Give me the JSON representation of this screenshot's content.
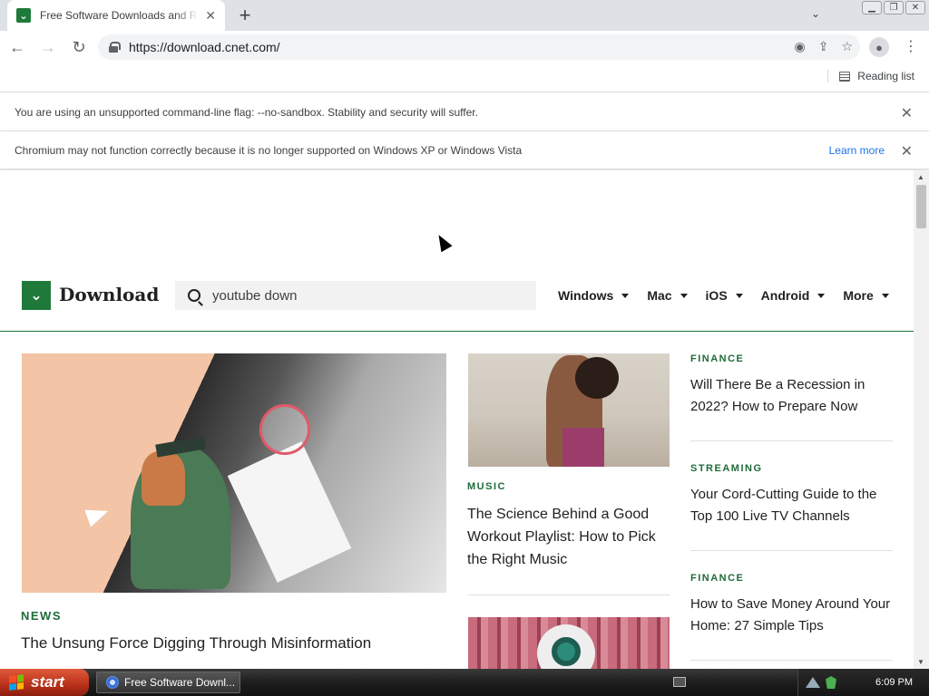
{
  "browser": {
    "tab_title": "Free Software Downloads and Reviews",
    "tab_favicon": "download-favicon",
    "url": "https://download.cnet.com/",
    "reading_list": "Reading list"
  },
  "infobars": {
    "sandbox_message": "You are using an unsupported command-line flag: --no-sandbox. Stability and security will suffer.",
    "xp_message": "Chromium may not function correctly because it is no longer supported on Windows XP or Windows Vista",
    "learn_more": "Learn more"
  },
  "site": {
    "logo_text": "Download",
    "search_value": "youtube down",
    "nav": [
      {
        "label": "Windows"
      },
      {
        "label": "Mac"
      },
      {
        "label": "iOS"
      },
      {
        "label": "Android"
      },
      {
        "label": "More"
      }
    ]
  },
  "articles": {
    "hero": {
      "category": "NEWS",
      "title": "The Unsung Force Digging Through Misinformation"
    },
    "middle": {
      "category": "MUSIC",
      "title": "The Science Behind a Good Workout Playlist: How to Pick the Right Music"
    },
    "side": [
      {
        "category": "FINANCE",
        "title": "Will There Be a Recession in 2022? How to Prepare Now"
      },
      {
        "category": "STREAMING",
        "title": "Your Cord-Cutting Guide to the Top 100 Live TV Channels"
      },
      {
        "category": "FINANCE",
        "title": "How to Save Money Around Your Home: 27 Simple Tips"
      }
    ]
  },
  "taskbar": {
    "start_label": "start",
    "task_label": "Free Software Downl...",
    "clock": "6:09 PM"
  },
  "colors": {
    "brand_green": "#1f7a3a",
    "category_green": "#1f6b3a",
    "link_blue": "#1a73e8"
  }
}
